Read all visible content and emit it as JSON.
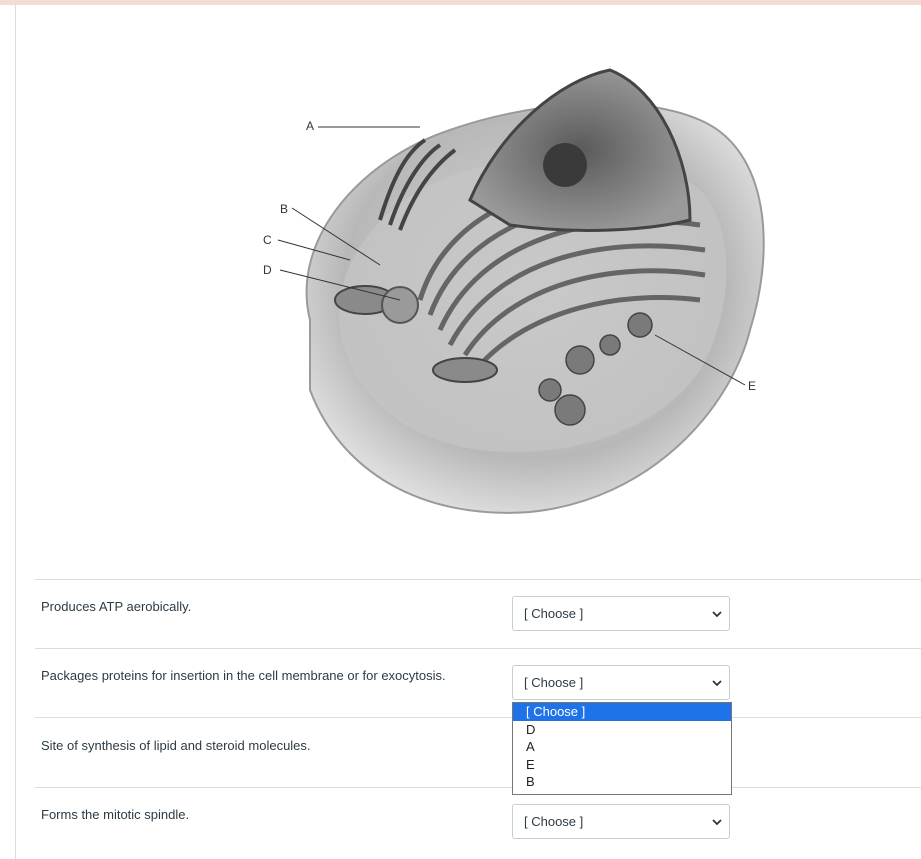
{
  "figure": {
    "labels": {
      "a": "A",
      "b": "B",
      "c": "C",
      "d": "D",
      "e": "E"
    }
  },
  "questions": [
    {
      "text": "Produces ATP aerobically.",
      "selected": "[ Choose ]"
    },
    {
      "text": "Packages proteins for insertion in the cell membrane or for exocytosis.",
      "selected": "[ Choose ]"
    },
    {
      "text": "Site of synthesis of lipid and steroid molecules.",
      "selected": "[ Choose ]"
    },
    {
      "text": "Forms the mitotic spindle.",
      "selected": "[ Choose ]"
    }
  ],
  "dropdown": {
    "options": [
      "[ Choose ]",
      "D",
      "A",
      "E",
      "B"
    ],
    "highlighted": "[ Choose ]"
  },
  "colors": {
    "highlight": "#1e73e8",
    "border": "#c7cdd1",
    "text": "#2d3b45",
    "top_strip": "#f4dcd6"
  },
  "icons": {
    "select_arrow": "chevron-down-icon"
  }
}
